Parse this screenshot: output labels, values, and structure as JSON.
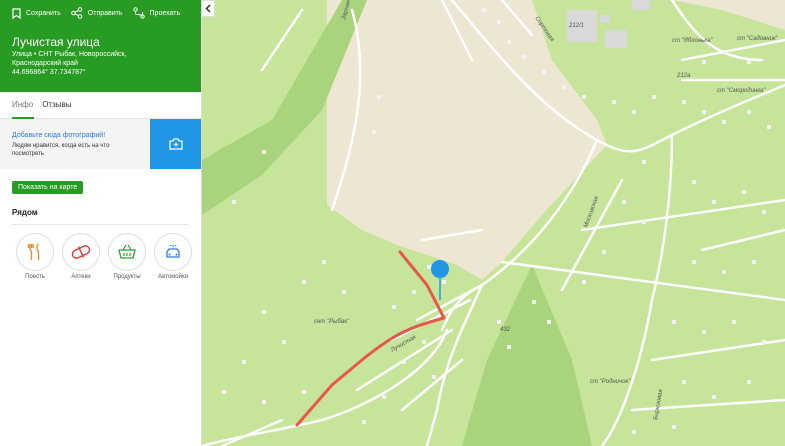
{
  "header": {
    "actions": {
      "save": "Сохранить",
      "send": "Отправить",
      "route": "Проехать"
    },
    "title": "Лучистая улица",
    "address_line1": "Улица • СНТ Рыбак, Новороссийск,",
    "address_line2": "Краснодарский край",
    "coordinates": "44.696864° 37.734787°"
  },
  "tabs": [
    "Инфо",
    "Отзывы"
  ],
  "photo": {
    "link": "Добавьте сюда фотографий!",
    "subtext": "Людям нравится, когда есть на что посмотреть"
  },
  "show_on_map": "Показать на карте",
  "nearby": {
    "title": "Рядом",
    "categories": [
      {
        "label": "Поесть",
        "icon": "food-icon"
      },
      {
        "label": "Аптеки",
        "icon": "pharmacy-icon"
      },
      {
        "label": "Продукты",
        "icon": "grocery-icon"
      },
      {
        "label": "Автомойки",
        "icon": "car-wash-icon"
      }
    ]
  },
  "map": {
    "labels": {
      "snt_rybak": "снт \"Рыбак\"",
      "st_yablonka": "ст \"Яблонька\"",
      "st_sadovnik": "ст \"Садовник\"",
      "st_smorodinka": "ст \"Смородинка\"",
      "st_rodnichok": "ст \"Родничок\"",
      "street_luchistaya": "Лучистая",
      "street_moskovskaya": "Московская",
      "street_sortovaya": "Сортовая",
      "street_zarnaya": "Зарная",
      "street_biryuzovaya": "Бирюзовая",
      "num_212_1": "212/1",
      "num_212a": "212а",
      "num_432": "432"
    },
    "colors": {
      "land": "#c6e49a",
      "field": "#ede6d3",
      "forest": "#a9d37c",
      "route": "#e8574a",
      "pin": "#2196e6"
    }
  }
}
